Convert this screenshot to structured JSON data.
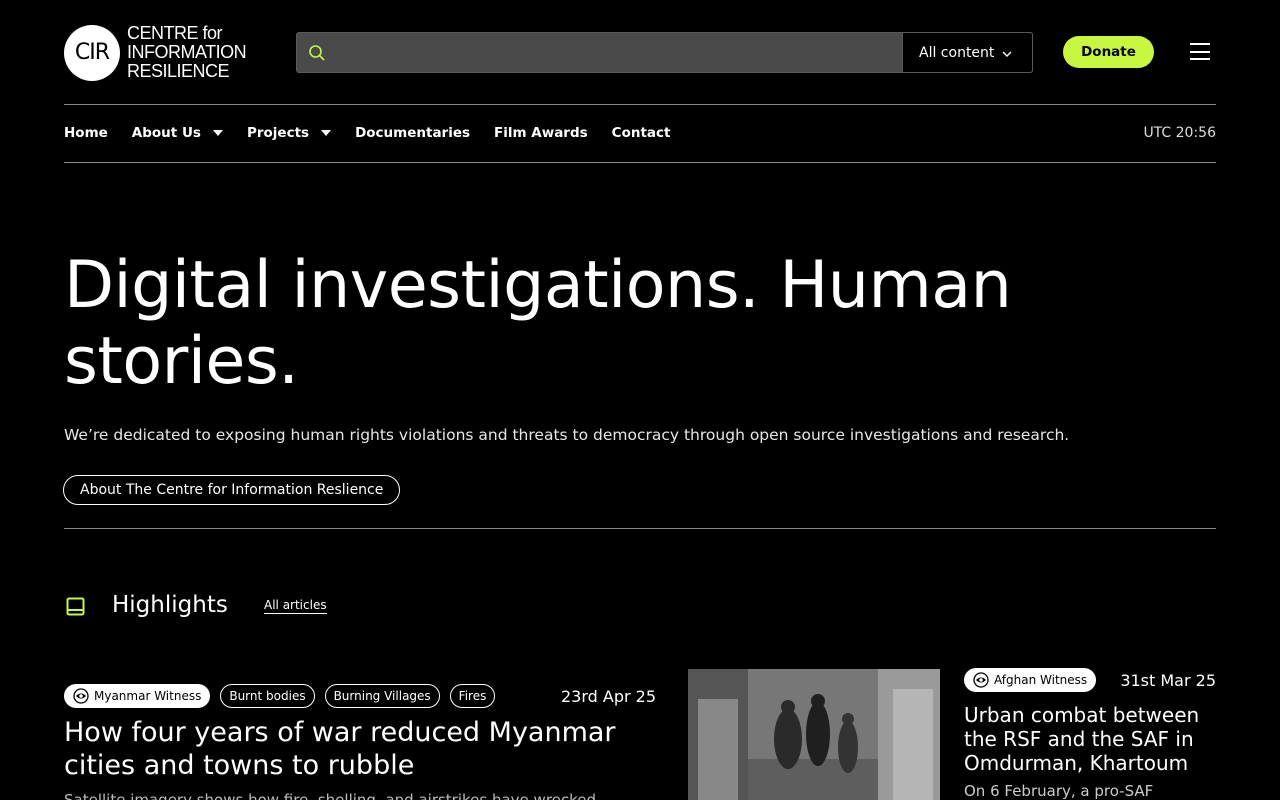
{
  "header": {
    "logo_mark": "CIR",
    "logo_line1": "CENTRE for",
    "logo_line2": "INFORMATION",
    "logo_line3": "RESILIENCE",
    "search_placeholder": "",
    "search_scope": "All content",
    "donate_label": "Donate",
    "accent_color": "#c8f73f"
  },
  "nav": {
    "items": [
      {
        "label": "Home"
      },
      {
        "label": "About Us"
      },
      {
        "label": "Projects"
      },
      {
        "label": "Documentaries"
      },
      {
        "label": "Film Awards"
      },
      {
        "label": "Contact"
      }
    ],
    "clock": "UTC 20:56"
  },
  "hero": {
    "title": "Digital investigations. Human stories.",
    "subtitle": "We’re dedicated to exposing human rights violations and threats to democracy through open source investigations and research.",
    "about_button": "About The Centre for Information Reslience"
  },
  "highlights": {
    "title": "Highlights",
    "all_link": "All articles",
    "articles": [
      {
        "tags": [
          "Myanmar Witness",
          "Burnt bodies",
          "Burning Villages",
          "Fires"
        ],
        "date": "23rd Apr 25",
        "title": "How four years of war reduced Myanmar cities and towns to rubble",
        "excerpt": "Satellite imagery shows how fire, shelling, and airstrikes have wrecked"
      },
      {
        "tags": [
          "Afghan Witness"
        ],
        "date": "31st Mar 25",
        "title": "Urban combat between the RSF and the SAF in Omdurman, Khartoum",
        "excerpt": "On 6 February, a pro-SAF"
      }
    ]
  }
}
